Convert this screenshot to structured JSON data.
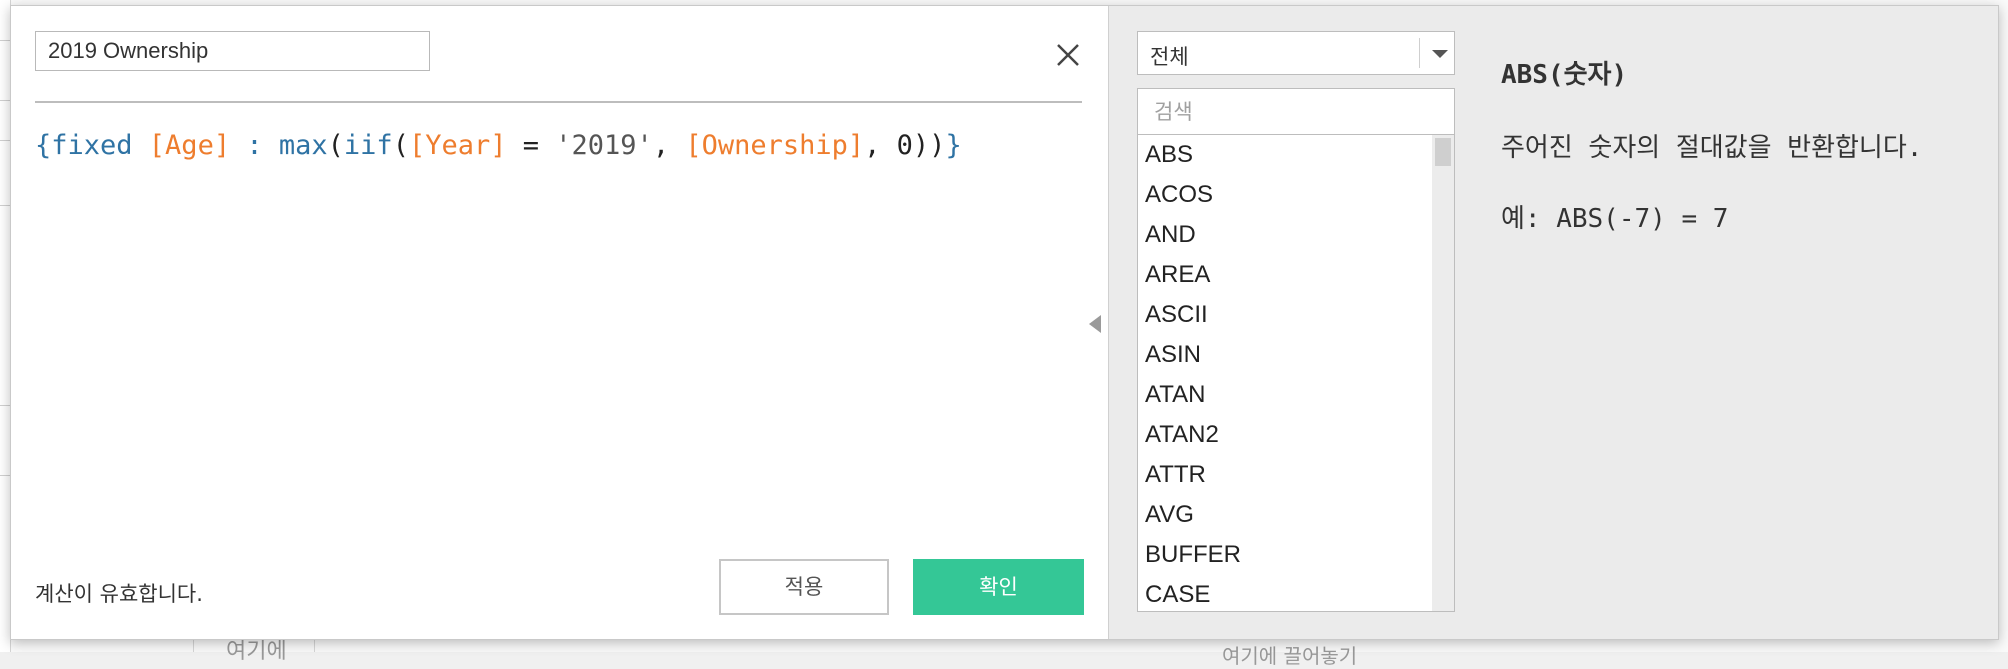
{
  "background": {
    "partial_texts": [
      "여기에",
      "여기에 끌어놓기"
    ]
  },
  "calc_name": "2019 Ownership",
  "formula": {
    "tokens": [
      {
        "text": "{fixed ",
        "kind": "kw"
      },
      {
        "text": "[Age]",
        "kind": "field"
      },
      {
        "text": " : ",
        "kind": "kw"
      },
      {
        "text": "max",
        "kind": "kw"
      },
      {
        "text": "(",
        "kind": "op"
      },
      {
        "text": "iif",
        "kind": "kw"
      },
      {
        "text": "(",
        "kind": "op"
      },
      {
        "text": "[Year]",
        "kind": "field"
      },
      {
        "text": " = ",
        "kind": "op"
      },
      {
        "text": "'2019'",
        "kind": "str"
      },
      {
        "text": ", ",
        "kind": "op"
      },
      {
        "text": "[Ownership]",
        "kind": "field"
      },
      {
        "text": ", 0))",
        "kind": "op"
      },
      {
        "text": "}",
        "kind": "kw"
      }
    ]
  },
  "status_text": "계산이 유효합니다.",
  "buttons": {
    "apply": "적용",
    "ok": "확인"
  },
  "category_select": {
    "value": "전체"
  },
  "search": {
    "placeholder": "검색"
  },
  "functions": [
    "ABS",
    "ACOS",
    "AND",
    "AREA",
    "ASCII",
    "ASIN",
    "ATAN",
    "ATAN2",
    "ATTR",
    "AVG",
    "BUFFER",
    "CASE"
  ],
  "description": {
    "title": "ABS(숫자)",
    "body": "주어진 숫자의 절대값을 반환합니다.",
    "example": "예: ABS(-7) = 7"
  },
  "colors": {
    "keyword": "#2f73a4",
    "field": "#ee7d2e",
    "string": "#555555",
    "ok_button": "#34c796"
  },
  "icons": {
    "close": "close-icon",
    "dropdown": "chevron-down-icon",
    "collapse": "triangle-left-icon"
  }
}
